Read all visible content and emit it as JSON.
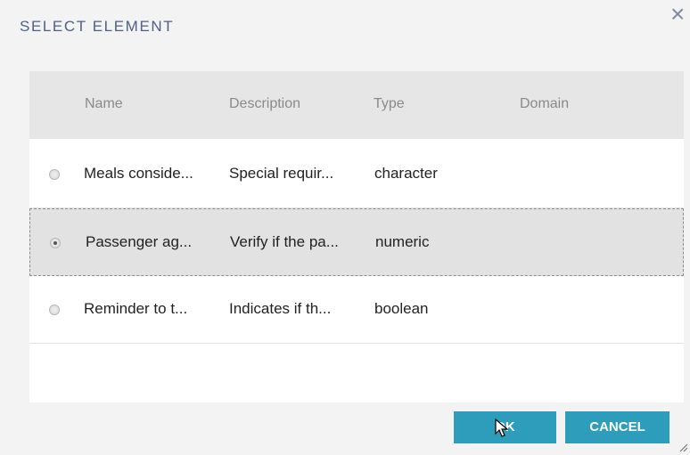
{
  "dialog": {
    "title": "SELECT ELEMENT",
    "close_icon": "close-icon"
  },
  "table": {
    "columns": [
      "Name",
      "Description",
      "Type",
      "Domain"
    ],
    "rows": [
      {
        "name": "Meals conside...",
        "description": "Special requir...",
        "type": "character",
        "domain": "",
        "selected": false
      },
      {
        "name": "Passenger ag...",
        "description": "Verify if the pa...",
        "type": "numeric",
        "domain": "",
        "selected": true
      },
      {
        "name": "Reminder to t...",
        "description": "Indicates if th...",
        "type": "boolean",
        "domain": "",
        "selected": false
      }
    ]
  },
  "buttons": {
    "ok": "OK",
    "cancel": "CANCEL"
  },
  "colors": {
    "accent": "#2e9dbb",
    "title": "#4f5f86"
  }
}
